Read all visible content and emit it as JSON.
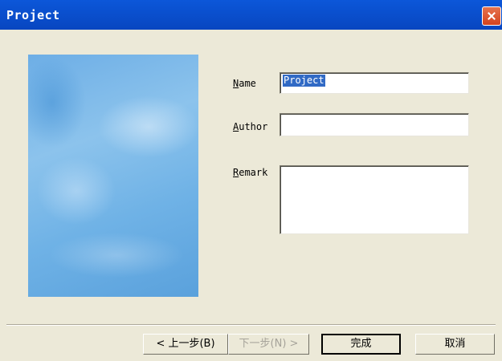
{
  "window": {
    "title": "Project"
  },
  "form": {
    "name_label_key": "N",
    "name_label_rest": "ame",
    "name_value": "Project",
    "author_label_key": "A",
    "author_label_rest": "uthor",
    "author_value": "",
    "remark_label_key": "R",
    "remark_label_rest": "emark",
    "remark_value": ""
  },
  "buttons": {
    "back": "< 上一步(B)",
    "next": "下一步(N) >",
    "finish": "完成",
    "cancel": "取消"
  },
  "icons": {
    "close": "close-icon",
    "banner": "wizard-banner-image"
  }
}
